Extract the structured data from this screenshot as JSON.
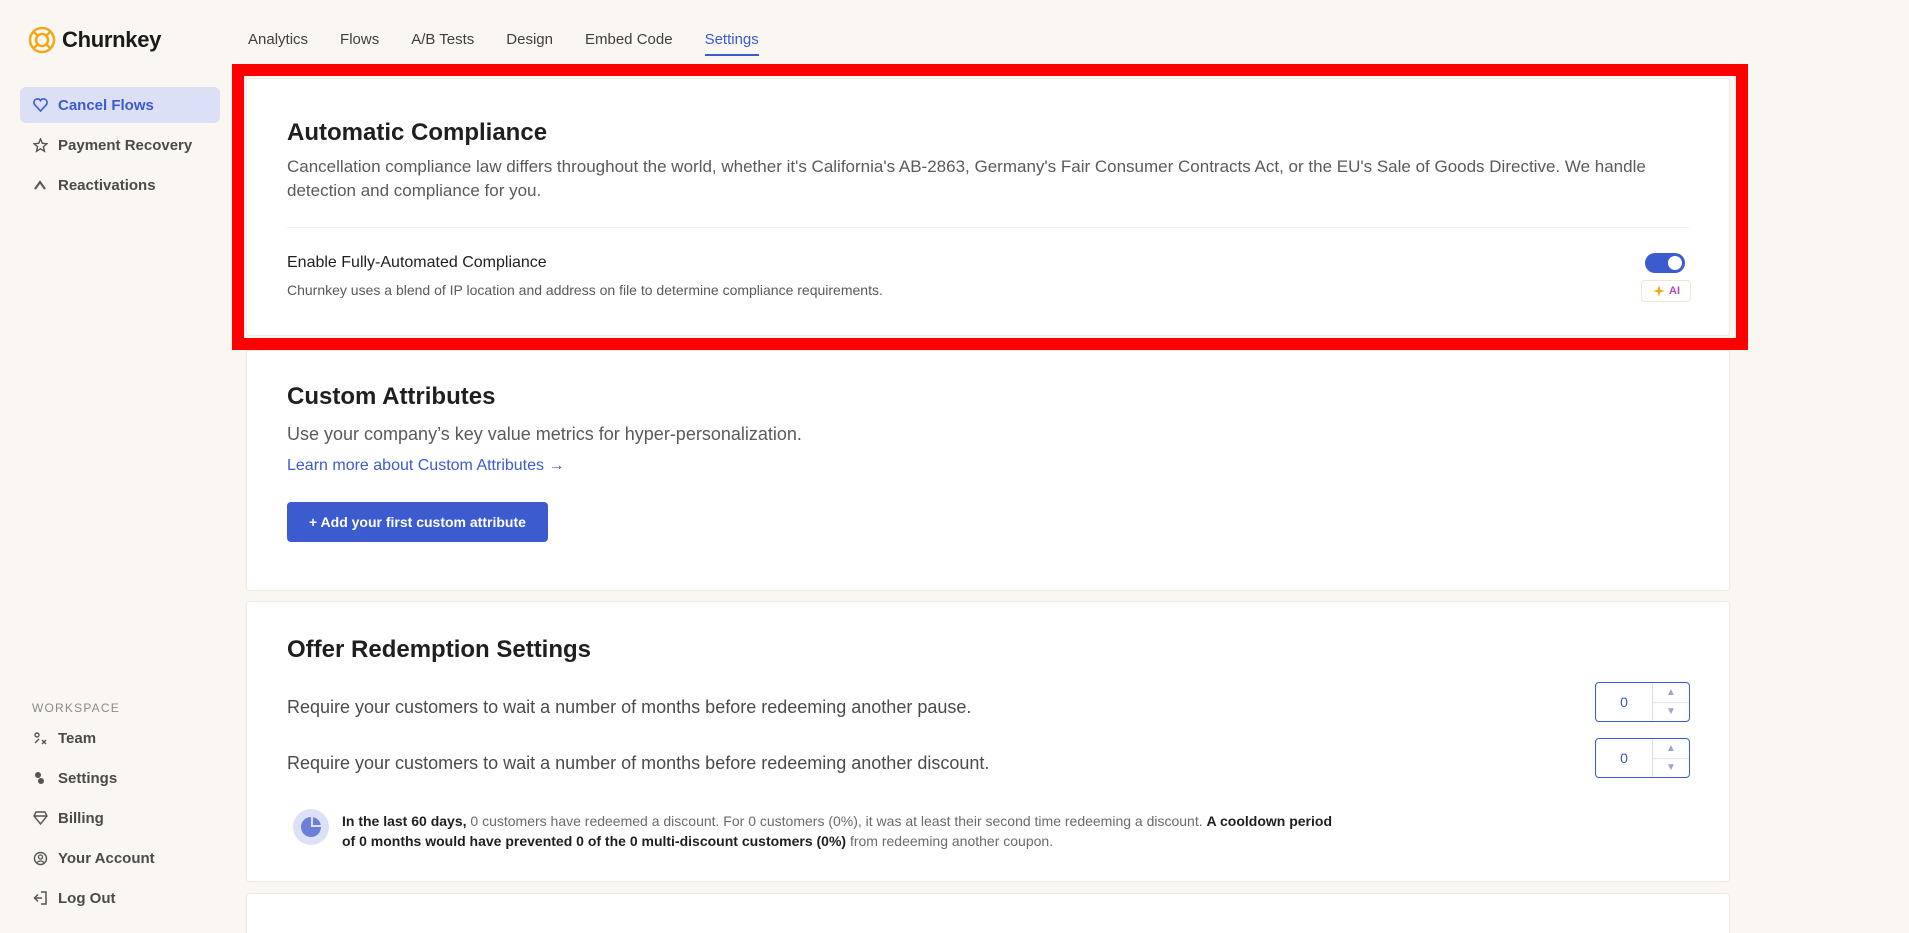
{
  "brand": {
    "name": "Churnkey"
  },
  "sidebar": {
    "items": [
      {
        "label": "Cancel Flows",
        "icon": "heart-icon"
      },
      {
        "label": "Payment Recovery",
        "icon": "star-badge-icon"
      },
      {
        "label": "Reactivations",
        "icon": "arrow-up-icon"
      }
    ],
    "workspace_label": "WORKSPACE",
    "workspace_items": [
      {
        "label": "Team",
        "icon": "team-icon"
      },
      {
        "label": "Settings",
        "icon": "settings-icon"
      },
      {
        "label": "Billing",
        "icon": "diamond-icon"
      },
      {
        "label": "Your Account",
        "icon": "account-icon"
      },
      {
        "label": "Log Out",
        "icon": "logout-icon"
      }
    ]
  },
  "tabs": [
    "Analytics",
    "Flows",
    "A/B Tests",
    "Design",
    "Embed Code",
    "Settings"
  ],
  "active_tab": "Settings",
  "compliance": {
    "title": "Automatic Compliance",
    "description": "Cancellation compliance law differs throughout the world, whether it's California's AB-2863, Germany's Fair Consumer Contracts Act, or the EU's Sale of Goods Directive. We handle detection and compliance for you.",
    "setting_label": "Enable Fully-Automated Compliance",
    "setting_desc": "Churnkey uses a blend of IP location and address on file to determine compliance requirements.",
    "enabled": true,
    "ai_badge": "AI"
  },
  "custom_attributes": {
    "title": "Custom Attributes",
    "description": "Use your company’s key value metrics for hyper-personalization.",
    "link": "Learn more about Custom Attributes →",
    "button": "+ Add your first custom attribute"
  },
  "offer_redemption": {
    "title": "Offer Redemption Settings",
    "pause_label": "Require your customers to wait a number of months before redeeming another pause.",
    "pause_value": "0",
    "discount_label": "Require your customers to wait a number of months before redeeming another discount.",
    "discount_value": "0",
    "stat_part1": "In the last 60 days,",
    "stat_part2": " 0 customers have redeemed a discount. For 0 customers (0%), it was at least their second time redeeming a discount. ",
    "stat_part3": "A cooldown period of 0 months would have prevented 0 of the 0 multi-discount customers (0%)",
    "stat_part4": " from redeeming another coupon."
  },
  "colors": {
    "accent": "#3b5bcf",
    "highlight": "#ff0000",
    "background": "#faf6f2"
  }
}
